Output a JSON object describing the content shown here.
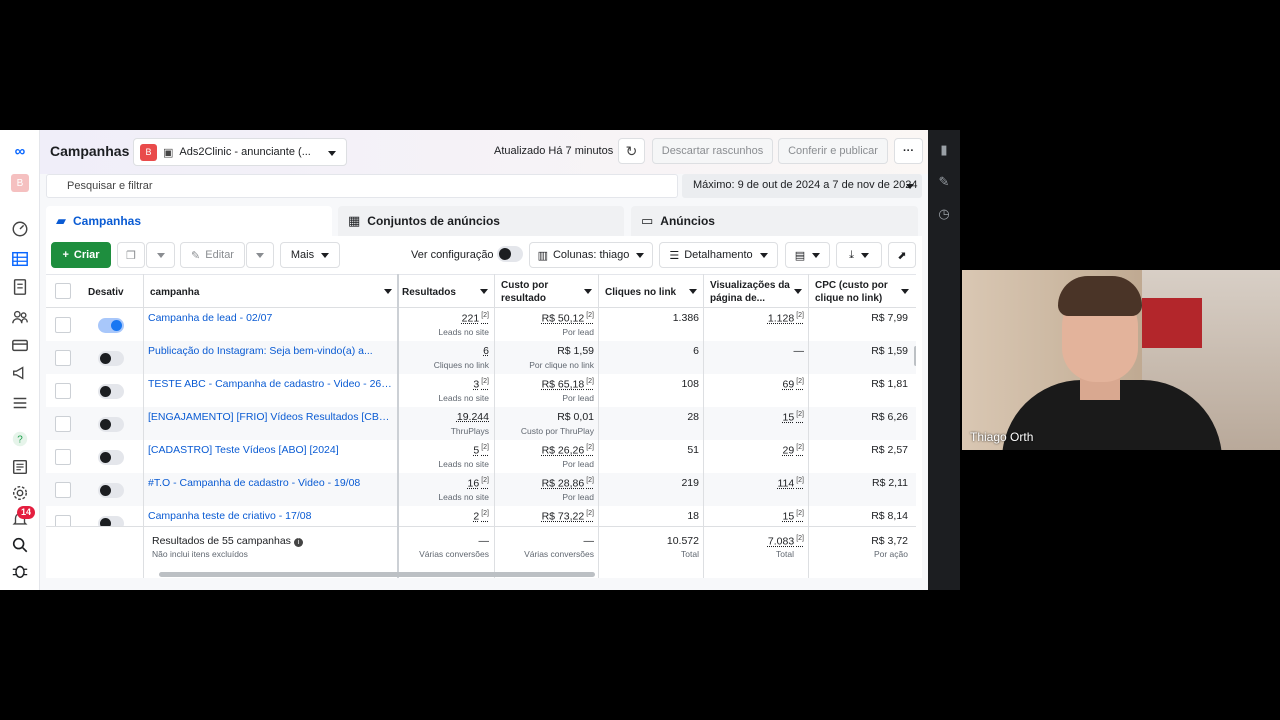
{
  "header": {
    "title": "Campanhas",
    "account_badge": "B",
    "account_name": "Ads2Clinic - anunciante (...",
    "updated": "Atualizado Há 7 minutos",
    "discard_label": "Descartar rascunhos",
    "review_label": "Conferir e publicar",
    "more_label": "···"
  },
  "search": {
    "placeholder": "Pesquisar e filtrar"
  },
  "date_range": "Máximo: 9 de out de 2024 a 7 de nov de 2024",
  "tabs": [
    {
      "label": "Campanhas",
      "icon": "folder-icon"
    },
    {
      "label": "Conjuntos de anúncios",
      "icon": "grid-icon"
    },
    {
      "label": "Anúncios",
      "icon": "ad-icon"
    }
  ],
  "toolbar": {
    "create_label": "Criar",
    "edit_label": "Editar",
    "more_label": "Mais",
    "view_config_label": "Ver configuração",
    "columns_label": "Colunas: thiago",
    "breakdown_label": "Detalhamento"
  },
  "table": {
    "columns": [
      "Desativ",
      "campanha",
      "Resultados",
      "Custo por resultado",
      "Cliques no link",
      "Visualizações da página de...",
      "CPC (custo por clique no link)"
    ],
    "rows": [
      {
        "active": true,
        "name": "Campanha de lead - 02/07",
        "results": "221",
        "results_sub": "Leads no site",
        "cost": "R$ 50,12",
        "cost_sub": "Por lead",
        "clicks": "1.386",
        "views": "1.128",
        "cpc": "R$ 7,99"
      },
      {
        "active": false,
        "name": "Publicação do Instagram: Seja bem-vindo(a) a...",
        "results": "6",
        "results_sub": "Cliques no link",
        "cost": "R$ 1,59",
        "cost_sub": "Por clique no link",
        "clicks": "6",
        "views": "—",
        "cpc": "R$ 1,59"
      },
      {
        "active": false,
        "name": "TESTE ABC - Campanha de cadastro - Video - 26/...",
        "results": "3",
        "results_sub": "Leads no site",
        "cost": "R$ 65,18",
        "cost_sub": "Por lead",
        "clicks": "108",
        "views": "69",
        "cpc": "R$ 1,81"
      },
      {
        "active": false,
        "name": "[ENGAJAMENTO] [FRIO] Vídeos Resultados [CBO...",
        "results": "19.244",
        "results_sub": "ThruPlays",
        "cost": "R$ 0,01",
        "cost_sub": "Custo por ThruPlay",
        "clicks": "28",
        "views": "15",
        "cpc": "R$ 6,26"
      },
      {
        "active": false,
        "name": "[CADASTRO] Teste Vídeos [ABO] [2024]",
        "results": "5",
        "results_sub": "Leads no site",
        "cost": "R$ 26,26",
        "cost_sub": "Por lead",
        "clicks": "51",
        "views": "29",
        "cpc": "R$ 2,57"
      },
      {
        "active": false,
        "name": "#T.O - Campanha de cadastro - Video - 19/08",
        "results": "16",
        "results_sub": "Leads no site",
        "cost": "R$ 28,86",
        "cost_sub": "Por lead",
        "clicks": "219",
        "views": "114",
        "cpc": "R$ 2,11"
      },
      {
        "active": false,
        "name": "Campanha teste de criativo - 17/08",
        "results": "2",
        "results_sub": "",
        "cost": "R$ 73,22",
        "cost_sub": "",
        "clicks": "18",
        "views": "15",
        "cpc": "R$ 8,14"
      }
    ],
    "footer": {
      "title": "Resultados de 55 campanhas",
      "subtitle": "Não inclui itens excluídos",
      "results": "—",
      "results_sub": "Várias conversões",
      "cost": "—",
      "cost_sub": "Várias conversões",
      "clicks": "10.572",
      "clicks_sub": "Total",
      "views": "7.083",
      "views_sub": "Total",
      "cpc": "R$ 3,72",
      "cpc_sub": "Por ação"
    }
  },
  "superscript": "[2]",
  "notifications_count": "14",
  "webcam": {
    "name": "Thiago Orth"
  },
  "colors": {
    "accent": "#0866ff",
    "create": "#1e8e3e",
    "link": "#0a5bd3"
  }
}
